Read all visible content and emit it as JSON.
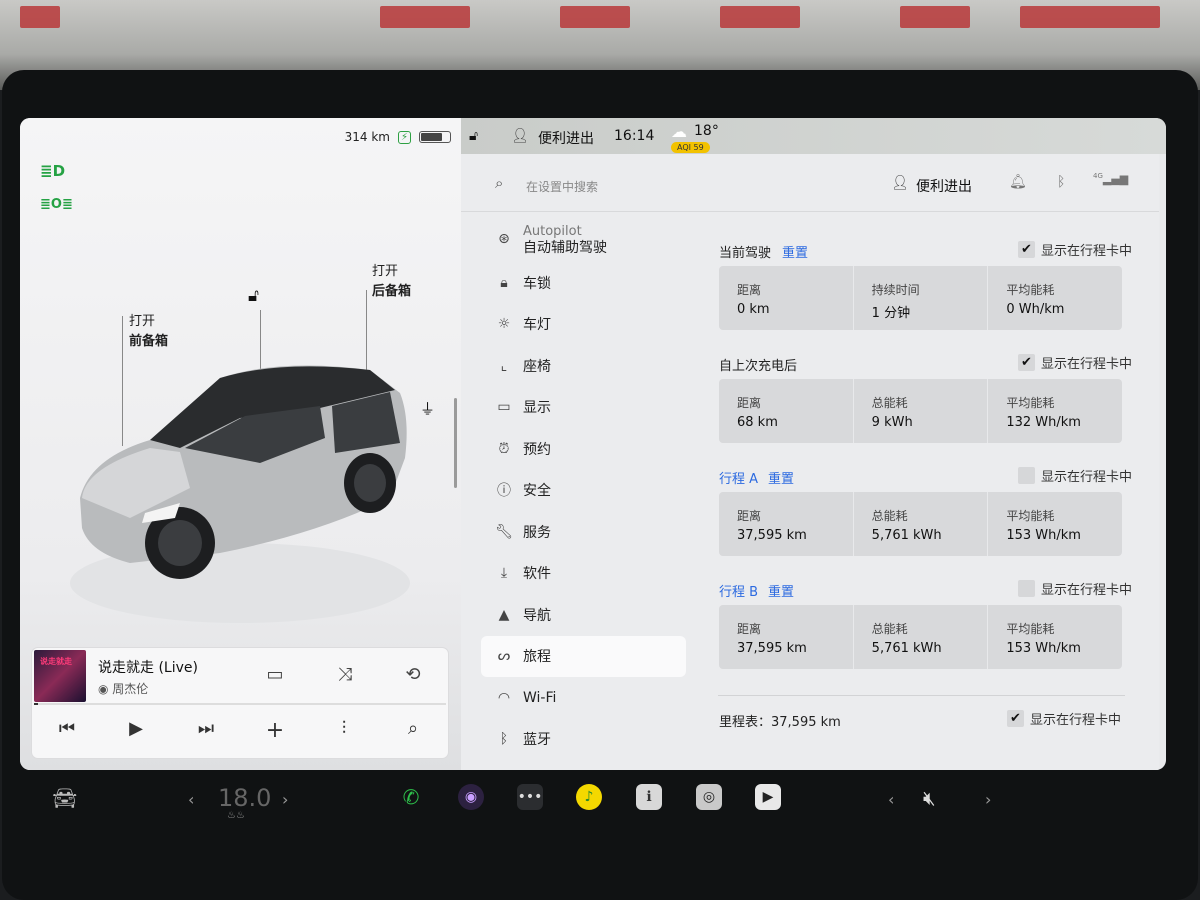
{
  "status_left": {
    "range": "314 km"
  },
  "doors": {
    "front_trunk": {
      "line1": "打开",
      "line2": "前备箱"
    },
    "rear_trunk": {
      "line1": "打开",
      "line2": "后备箱"
    }
  },
  "music": {
    "song": "说走就走 (Live)",
    "artist": "周杰伦",
    "progress_fraction": 0.01
  },
  "topbar": {
    "profile": "便利进出",
    "time": "16:14",
    "temperature": "18°",
    "aqi": "AQI 59"
  },
  "settings": {
    "search_placeholder": "在设置中搜索",
    "profile": "便利进出",
    "network": "4G",
    "nav": [
      {
        "label": "Autopilot",
        "sub": "自动辅助驾驶",
        "icon": "steering-wheel-icon"
      },
      {
        "label": "车锁",
        "icon": "lock-icon"
      },
      {
        "label": "车灯",
        "icon": "sun-icon"
      },
      {
        "label": "座椅",
        "icon": "seat-icon"
      },
      {
        "label": "显示",
        "icon": "display-icon"
      },
      {
        "label": "预约",
        "icon": "alarm-clock-icon"
      },
      {
        "label": "安全",
        "icon": "alert-icon"
      },
      {
        "label": "服务",
        "icon": "wrench-icon"
      },
      {
        "label": "软件",
        "icon": "download-icon"
      },
      {
        "label": "导航",
        "icon": "navigation-arrow-icon"
      },
      {
        "label": "旅程",
        "icon": "trip-icon",
        "active": true
      },
      {
        "label": "Wi-Fi",
        "icon": "wifi-icon"
      },
      {
        "label": "蓝牙",
        "icon": "bluetooth-icon"
      }
    ],
    "show_in_card": "显示在行程卡中",
    "reset": "重置",
    "sections": [
      {
        "title": "当前驾驶",
        "has_reset": true,
        "checked": true,
        "stats": [
          {
            "label": "距离",
            "value": "0 km"
          },
          {
            "label": "持续时间",
            "value": "1 分钟"
          },
          {
            "label": "平均能耗",
            "value": "0 Wh/km"
          }
        ]
      },
      {
        "title": "自上次充电后",
        "has_reset": false,
        "checked": true,
        "stats": [
          {
            "label": "距离",
            "value": "68 km"
          },
          {
            "label": "总能耗",
            "value": "9 kWh"
          },
          {
            "label": "平均能耗",
            "value": "132 Wh/km"
          }
        ]
      },
      {
        "title": "行程 A",
        "has_reset": true,
        "checked": false,
        "stats": [
          {
            "label": "距离",
            "value": "37,595 km"
          },
          {
            "label": "总能耗",
            "value": "5,761 kWh"
          },
          {
            "label": "平均能耗",
            "value": "153 Wh/km"
          }
        ]
      },
      {
        "title": "行程 B",
        "has_reset": true,
        "checked": false,
        "stats": [
          {
            "label": "距离",
            "value": "37,595 km"
          },
          {
            "label": "总能耗",
            "value": "5,761 kWh"
          },
          {
            "label": "平均能耗",
            "value": "153 Wh/km"
          }
        ]
      }
    ],
    "odometer": "里程表：37,595 km",
    "odometer_checked": true
  },
  "dock": {
    "temperature": "18.0"
  }
}
